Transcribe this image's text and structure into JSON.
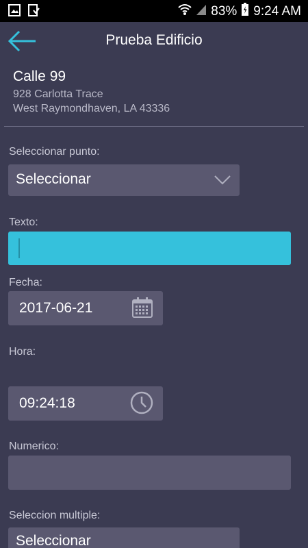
{
  "status_bar": {
    "battery_percent": "83%",
    "time": "9:24 AM",
    "icons": [
      "image-icon",
      "download-done-icon",
      "wifi-icon",
      "signal-icon",
      "battery-icon"
    ]
  },
  "app_bar": {
    "title": "Prueba Edificio",
    "back_icon": "arrow-left-icon",
    "accent_color": "#35c1dc"
  },
  "address": {
    "name": "Calle 99",
    "line1": "928 Carlotta Trace",
    "line2": "West Raymondhaven, LA 43336"
  },
  "form": {
    "point": {
      "label": "Seleccionar punto:",
      "value": "Seleccionar"
    },
    "text": {
      "label": "Texto:",
      "value": ""
    },
    "date": {
      "label": "Fecha:",
      "value": "2017-06-21",
      "icon": "calendar-icon"
    },
    "time": {
      "label": "Hora:",
      "value": "09:24:18",
      "icon": "clock-icon"
    },
    "numeric": {
      "label": "Numerico:",
      "value": ""
    },
    "multi": {
      "label": "Seleccion multiple:",
      "value": "Seleccionar"
    }
  }
}
